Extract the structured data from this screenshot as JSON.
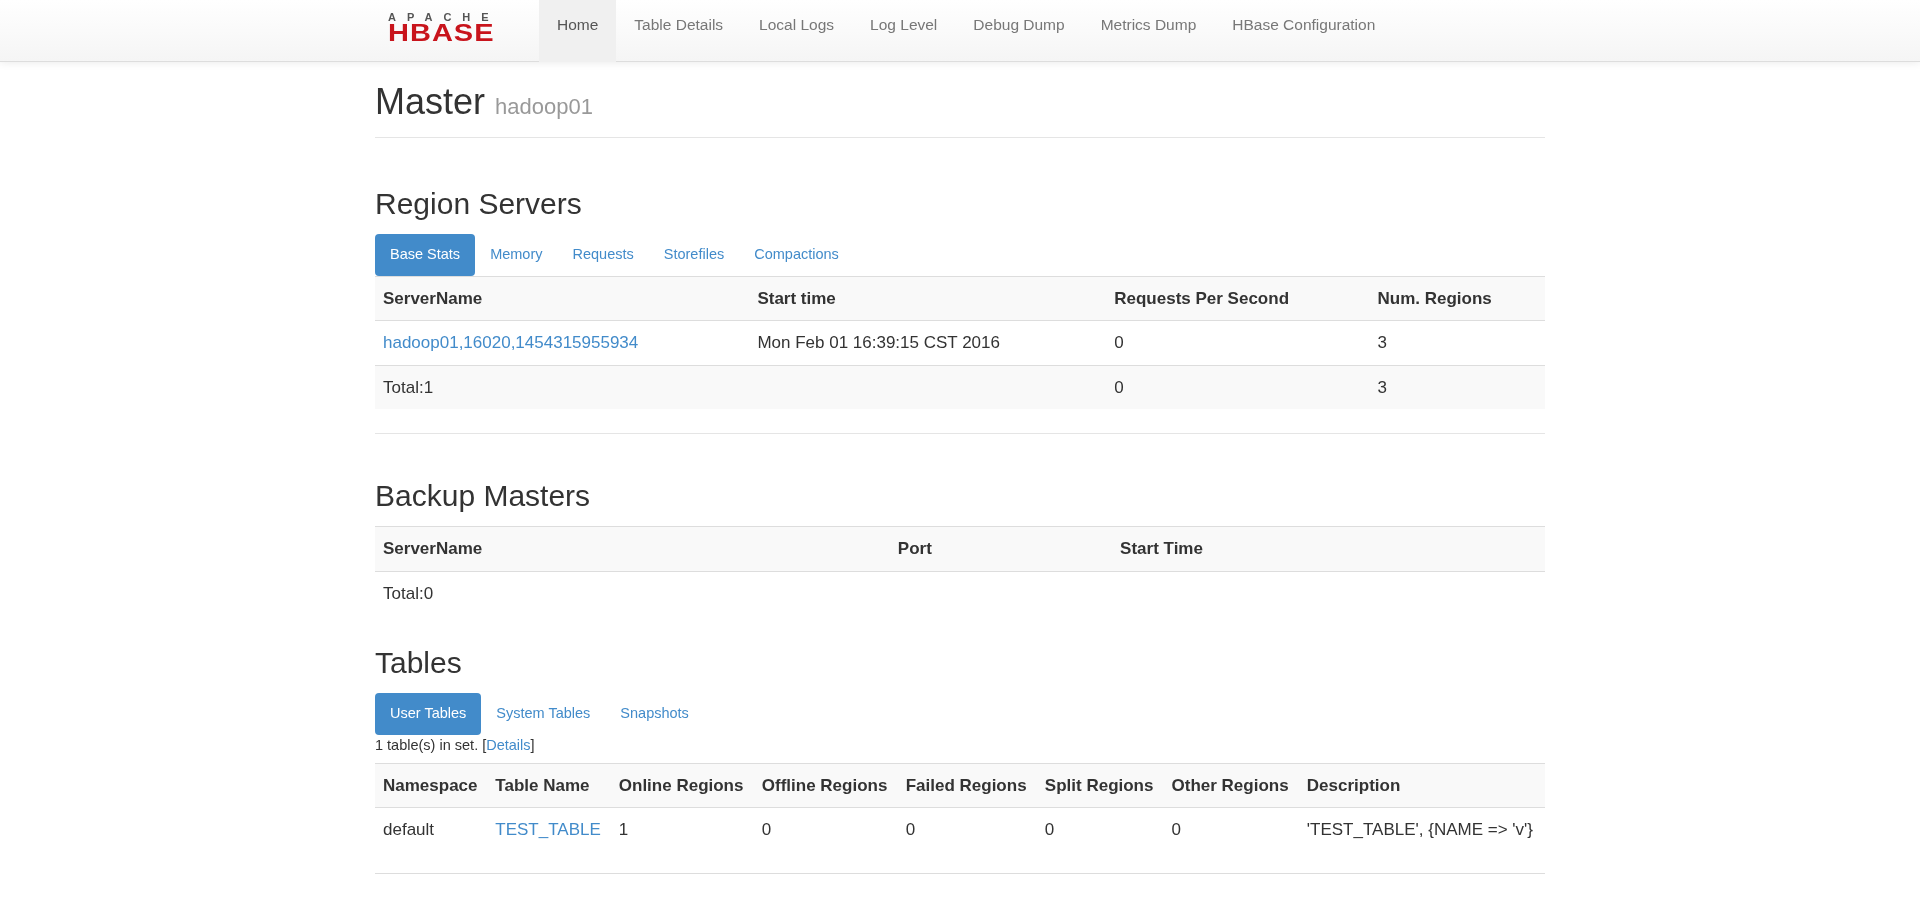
{
  "navbar": {
    "logo": {
      "top": "APACHE",
      "main": "HBASE"
    },
    "items": [
      {
        "label": "Home",
        "selected": true
      },
      {
        "label": "Table Details",
        "selected": false
      },
      {
        "label": "Local Logs",
        "selected": false
      },
      {
        "label": "Log Level",
        "selected": false
      },
      {
        "label": "Debug Dump",
        "selected": false
      },
      {
        "label": "Metrics Dump",
        "selected": false
      },
      {
        "label": "HBase Configuration",
        "selected": false
      }
    ]
  },
  "header": {
    "title": "Master",
    "subtitle": "hadoop01"
  },
  "region_servers": {
    "title": "Region Servers",
    "tabs": [
      {
        "label": "Base Stats",
        "selected": true
      },
      {
        "label": "Memory",
        "selected": false
      },
      {
        "label": "Requests",
        "selected": false
      },
      {
        "label": "Storefiles",
        "selected": false
      },
      {
        "label": "Compactions",
        "selected": false
      }
    ],
    "columns": [
      "ServerName",
      "Start time",
      "Requests Per Second",
      "Num. Regions"
    ],
    "rows": [
      {
        "kind": "link",
        "cells": [
          "hadoop01,16020,1454315955934",
          "Mon Feb 01 16:39:15 CST 2016",
          "0",
          "3"
        ]
      },
      {
        "kind": "text",
        "cells": [
          "Total:1",
          "",
          "0",
          "3"
        ]
      }
    ]
  },
  "backup_masters": {
    "title": "Backup Masters",
    "columns": [
      "ServerName",
      "Port",
      "Start Time"
    ],
    "total": "Total:0"
  },
  "tables": {
    "title": "Tables",
    "tabs": [
      {
        "label": "User Tables",
        "selected": true
      },
      {
        "label": "System Tables",
        "selected": false
      },
      {
        "label": "Snapshots",
        "selected": false
      }
    ],
    "summary": {
      "before": "1 table(s) in set. [",
      "link": "Details",
      "after": "]"
    },
    "columns": [
      "Namespace",
      "Table Name",
      "Online Regions",
      "Offline Regions",
      "Failed Regions",
      "Split Regions",
      "Other Regions",
      "Description"
    ],
    "rows": [
      {
        "cells": [
          "default",
          "TEST_TABLE",
          "1",
          "0",
          "0",
          "0",
          "0",
          "'TEST_TABLE', {NAME => 'v'}"
        ]
      }
    ]
  }
}
